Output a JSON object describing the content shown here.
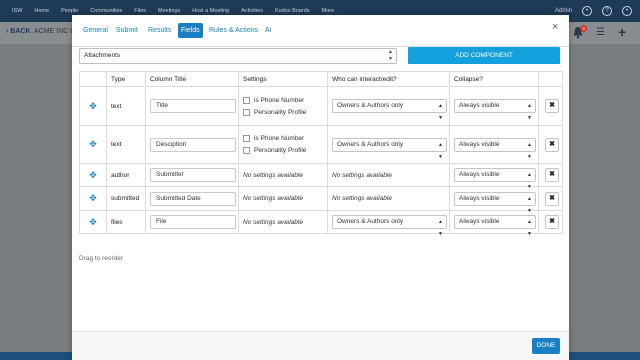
{
  "background": {
    "nav": [
      "ISW",
      "Home",
      "People",
      "Communities",
      "Files",
      "Meetings",
      "Host a Meeting",
      "Activities",
      "Kudos Boards",
      "More"
    ],
    "user": "Admin",
    "back_label": "BACK",
    "org_label": "ACME INC C",
    "notification_count": "3"
  },
  "modal": {
    "tabs": [
      "General",
      "Submit",
      "Results",
      "Fields",
      "Rules & Actions",
      "AI"
    ],
    "active_tab": "Fields",
    "close_icon": "×",
    "attachments_select": "Attachments",
    "add_component_label": "ADD COMPONENT",
    "columns": [
      "Type",
      "Column Title",
      "Settings",
      "Who can interact/edit?",
      "Collapse?"
    ],
    "rows": [
      {
        "type": "text",
        "title": "Title",
        "settings": [
          "is Phone Number",
          "Personality Profile"
        ],
        "who": "Owners & Authors only",
        "collapse": "Always visible"
      },
      {
        "type": "text",
        "title": "Desciption",
        "settings": [
          "is Phone Number",
          "Personality Profile"
        ],
        "who": "Owners & Authors only",
        "collapse": "Always visible"
      },
      {
        "type": "author",
        "title": "Submitter",
        "settings_text": "No settings available",
        "who_text": "No settings available",
        "collapse": "Always visible"
      },
      {
        "type": "submitted",
        "title": "Submitted Date",
        "settings_text": "No settings available",
        "who_text": "No settings available",
        "collapse": "Always visible"
      },
      {
        "type": "files",
        "title": "File",
        "settings_text": "No settings available",
        "who": "Owners & Authors only",
        "collapse": "Always visible"
      }
    ],
    "reorder_hint": "Drag to reorder",
    "done_label": "DONE"
  },
  "colors": {
    "accent": "#1a7fc4",
    "add_button": "#14a0dc",
    "nav_bg": "#1f3a57",
    "badge": "#d9342b"
  }
}
